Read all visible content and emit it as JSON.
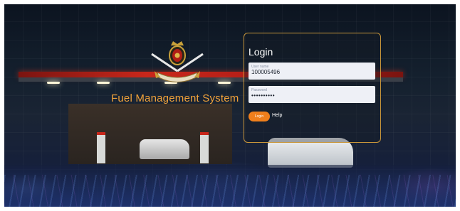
{
  "app": {
    "system_title": "Fuel Management System",
    "emblem_icon": "sri-lanka-army-emblem-icon"
  },
  "login": {
    "heading": "Login",
    "username": {
      "label": "User name",
      "value": "100005496"
    },
    "password": {
      "label": "Password",
      "value": "••••••••••"
    },
    "login_button": "Login",
    "help_link": "Help"
  },
  "colors": {
    "title_orange": "#f0a23a",
    "button_orange": "#f07f1c",
    "panel_border": "#c9963a"
  }
}
